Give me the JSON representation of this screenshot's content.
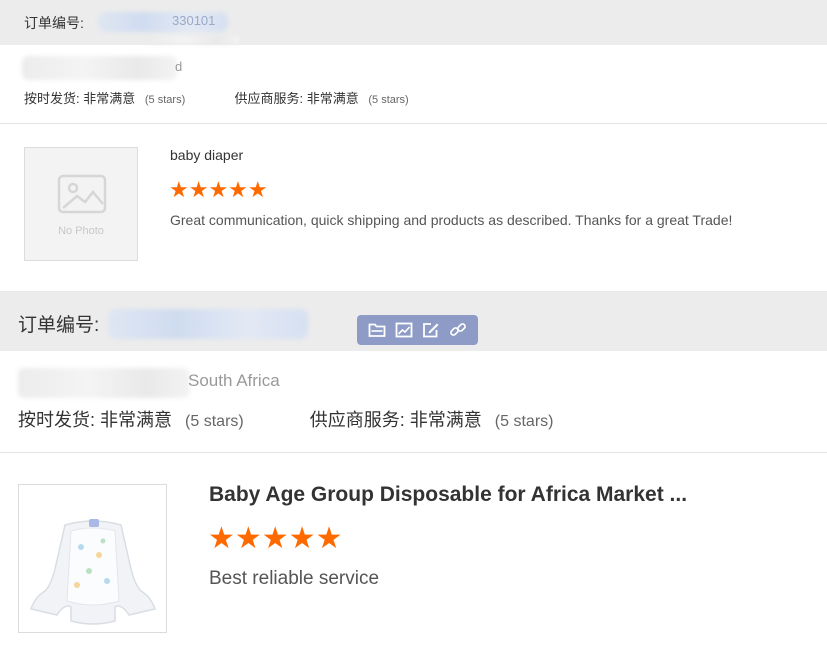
{
  "orders": [
    {
      "order_label": "订单编号:",
      "order_number_visible": "330101",
      "location": "d",
      "ratings": {
        "on_time_label": "按时发货:",
        "on_time_value": "非常满意",
        "on_time_stars": "(5 stars)",
        "supplier_label": "供应商服务:",
        "supplier_value": "非常满意",
        "supplier_stars": "(5 stars)"
      },
      "product": {
        "image_placeholder": "No Photo",
        "title": "baby diaper",
        "stars": "★★★★★",
        "rating_value": 5,
        "review": "Great communication, quick shipping and products as described. Thanks for a great Trade!"
      }
    },
    {
      "order_label": "订单编号:",
      "location": "South Africa",
      "ratings": {
        "on_time_label": "按时发货:",
        "on_time_value": "非常满意",
        "on_time_stars": "(5 stars)",
        "supplier_label": "供应商服务:",
        "supplier_value": "非常满意",
        "supplier_stars": "(5 stars)"
      },
      "product": {
        "title": "Baby Age Group Disposable for Africa Market ...",
        "stars": "★★★★★",
        "rating_value": 5,
        "review": "Best reliable service"
      }
    }
  ],
  "toolbar": {
    "icons": [
      "folder-icon",
      "image-icon",
      "edit-icon",
      "link-icon"
    ]
  },
  "colors": {
    "star": "#ff6a00",
    "order_bar": "#ececec",
    "toolbar": "#8e9bc6"
  }
}
